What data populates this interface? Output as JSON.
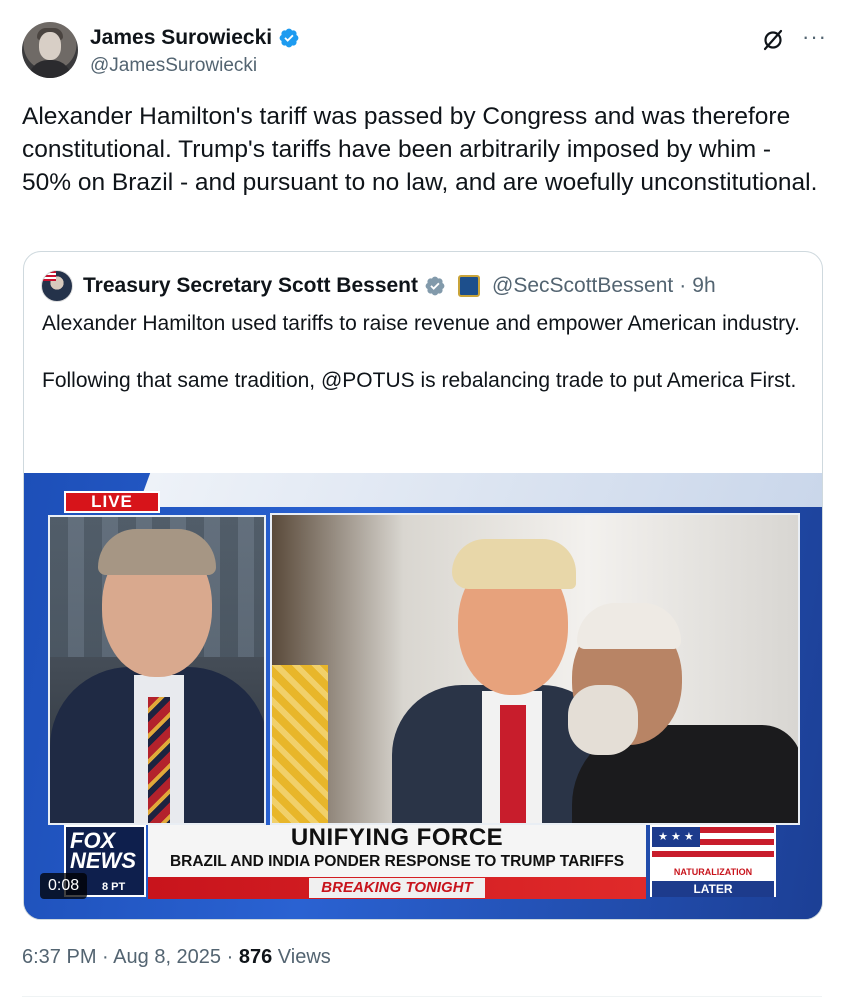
{
  "author": {
    "name": "James Surowiecki",
    "handle": "@JamesSurowiecki",
    "verified": true
  },
  "tweet": {
    "text": "Alexander Hamilton's tariff was passed by Congress and was therefore constitutional. Trump's tariffs have been arbitrarily imposed by whim - 50% on Brazil - and pursuant to no law, and are woefully unconstitutional."
  },
  "quoted": {
    "name": "Treasury Secretary Scott Bessent",
    "handle": "@SecScottBessent",
    "separator": "·",
    "time": "9h",
    "text_p1": "Alexander Hamilton used tariffs to raise revenue and empower American industry.",
    "text_p2": "Following that same tradition, @POTUS is rebalancing trade to put America First."
  },
  "video": {
    "live_label": "LIVE",
    "headline": "UNIFYING FORCE",
    "subhead": "BRAZIL AND INDIA PONDER RESPONSE TO TRUMP TARIFFS",
    "breaking": "BREAKING TONIGHT",
    "network_line1": "FOX",
    "network_line2": "NEWS",
    "network_time": "8 PT",
    "promo_title": "NATURALIZATION CEREMONY",
    "promo_when": "LATER",
    "promo_stars": "★ ★ ★",
    "duration": "0:08"
  },
  "meta": {
    "time": "6:37 PM",
    "dot1": "·",
    "date": "Aug 8, 2025",
    "dot2": "·",
    "views_count": "876",
    "views_label": "Views"
  },
  "icons": {
    "verified": "verified-badge-icon",
    "grok": "grok-icon",
    "more": "more-icon"
  },
  "colors": {
    "verified_blue": "#1d9bf0",
    "secondary_text": "#536471",
    "gov_verified_gray": "#829aab"
  }
}
